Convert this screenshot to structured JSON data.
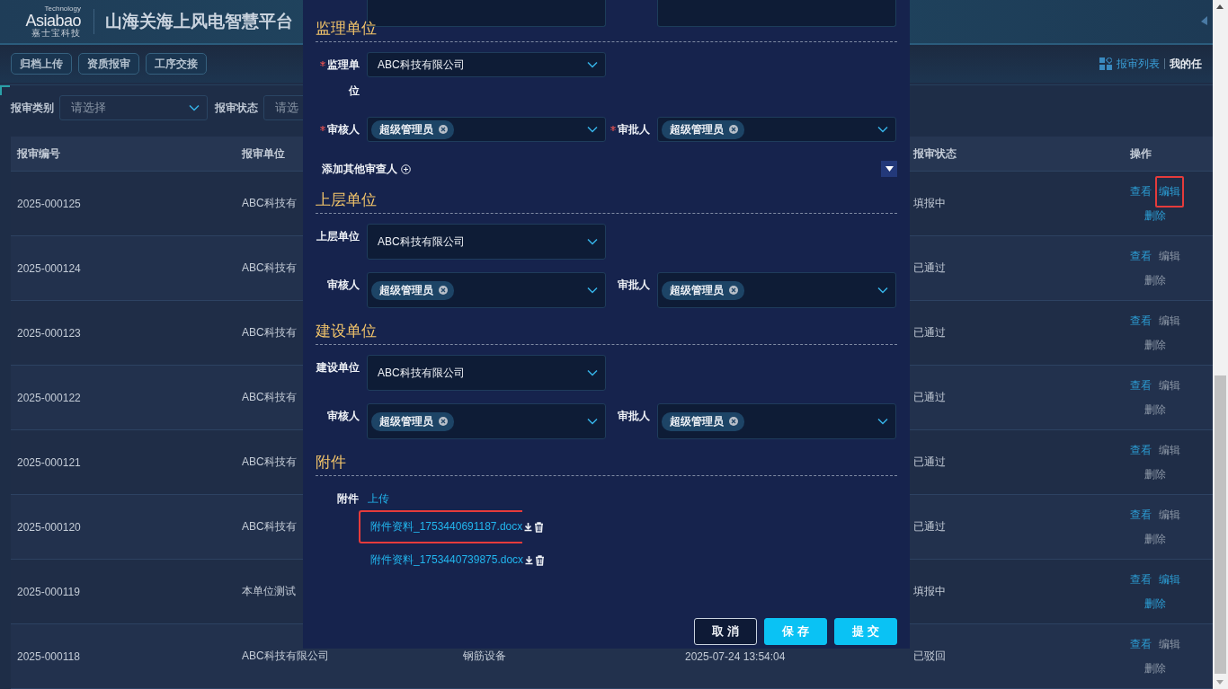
{
  "header": {
    "logo": {
      "tagline": "Technology",
      "name": "Asiabao",
      "subtitle": "嘉士宝科技"
    },
    "title": "山海关海上风电智慧平台"
  },
  "toolbar": {
    "buttons": [
      "归档上传",
      "资质报审",
      "工序交接"
    ],
    "tabs": [
      {
        "label": "报审列表",
        "selected": true
      },
      {
        "label": "我的任",
        "selected": false
      }
    ]
  },
  "filters": [
    {
      "label": "报审类别",
      "placeholder": "请选择"
    },
    {
      "label": "报审状态",
      "placeholder": "请选"
    }
  ],
  "table": {
    "columns": {
      "number": "报审编号",
      "unit": "报审单位",
      "status": "报审状态",
      "actions": "操作"
    },
    "rows": [
      {
        "number": "2025-000125",
        "unit": "ABC科技有",
        "status": "填报中",
        "actions": [
          {
            "label": "查看",
            "enabled": true,
            "highlighted": false
          },
          {
            "label": "编辑",
            "enabled": true,
            "highlighted": true
          },
          {
            "label": "删除",
            "enabled": true,
            "highlighted": false
          }
        ]
      },
      {
        "number": "2025-000124",
        "unit": "ABC科技有",
        "status": "已通过",
        "actions": [
          {
            "label": "查看",
            "enabled": true,
            "highlighted": false
          },
          {
            "label": "编辑",
            "enabled": false,
            "highlighted": false
          },
          {
            "label": "删除",
            "enabled": false,
            "highlighted": false
          }
        ]
      },
      {
        "number": "2025-000123",
        "unit": "ABC科技有",
        "status": "已通过",
        "actions": [
          {
            "label": "查看",
            "enabled": true,
            "highlighted": false
          },
          {
            "label": "编辑",
            "enabled": false,
            "highlighted": false
          },
          {
            "label": "删除",
            "enabled": false,
            "highlighted": false
          }
        ]
      },
      {
        "number": "2025-000122",
        "unit": "ABC科技有",
        "status": "已通过",
        "actions": [
          {
            "label": "查看",
            "enabled": true,
            "highlighted": false
          },
          {
            "label": "编辑",
            "enabled": false,
            "highlighted": false
          },
          {
            "label": "删除",
            "enabled": false,
            "highlighted": false
          }
        ]
      },
      {
        "number": "2025-000121",
        "unit": "ABC科技有",
        "status": "已通过",
        "actions": [
          {
            "label": "查看",
            "enabled": true,
            "highlighted": false
          },
          {
            "label": "编辑",
            "enabled": false,
            "highlighted": false
          },
          {
            "label": "删除",
            "enabled": false,
            "highlighted": false
          }
        ]
      },
      {
        "number": "2025-000120",
        "unit": "ABC科技有",
        "status": "已通过",
        "actions": [
          {
            "label": "查看",
            "enabled": true,
            "highlighted": false
          },
          {
            "label": "编辑",
            "enabled": false,
            "highlighted": false
          },
          {
            "label": "删除",
            "enabled": false,
            "highlighted": false
          }
        ]
      },
      {
        "number": "2025-000119",
        "unit": "本单位测试",
        "status": "填报中",
        "actions": [
          {
            "label": "查看",
            "enabled": true,
            "highlighted": false
          },
          {
            "label": "编辑",
            "enabled": true,
            "highlighted": false
          },
          {
            "label": "删除",
            "enabled": true,
            "highlighted": false
          }
        ]
      },
      {
        "number": "2025-000118",
        "unit": "ABC科技有限公司",
        "column_3": "钢筋设备",
        "column_4": "2025-07-24 13:54:04",
        "status": "已驳回",
        "actions": [
          {
            "label": "查看",
            "enabled": true,
            "highlighted": false
          },
          {
            "label": "编辑",
            "enabled": false,
            "highlighted": false
          },
          {
            "label": "删除",
            "enabled": false,
            "highlighted": false
          }
        ]
      }
    ]
  },
  "modal": {
    "sections": [
      {
        "title": "监理单位",
        "fields": [
          {
            "label": "监理单位",
            "required": true,
            "kind": "select",
            "value": "ABC科技有限公司"
          },
          {
            "label": "审核人",
            "required": true,
            "kind": "tags",
            "tags": [
              "超级管理员"
            ]
          },
          {
            "label": "审批人",
            "required": true,
            "kind": "tags",
            "tags": [
              "超级管理员"
            ]
          }
        ],
        "add_link": "添加其他审查人"
      },
      {
        "title": "上层单位",
        "fields": [
          {
            "label": "上层单位",
            "required": false,
            "kind": "select",
            "value": "ABC科技有限公司"
          },
          {
            "label": "审核人",
            "required": false,
            "kind": "tags",
            "tags": [
              "超级管理员"
            ]
          },
          {
            "label": "审批人",
            "required": false,
            "kind": "tags",
            "tags": [
              "超级管理员"
            ]
          }
        ]
      },
      {
        "title": "建设单位",
        "fields": [
          {
            "label": "建设单位",
            "required": false,
            "kind": "select",
            "value": "ABC科技有限公司"
          },
          {
            "label": "审核人",
            "required": false,
            "kind": "tags",
            "tags": [
              "超级管理员"
            ]
          },
          {
            "label": "审批人",
            "required": false,
            "kind": "tags",
            "tags": [
              "超级管理员"
            ]
          }
        ]
      }
    ],
    "attachments": {
      "title": "附件",
      "label": "附件",
      "upload": "上传",
      "files": [
        {
          "name": "附件资料_1753440691187.docx",
          "highlighted": true
        },
        {
          "name": "附件资料_1753440739875.docx",
          "highlighted": false
        }
      ]
    },
    "buttons": [
      {
        "label": "取消",
        "kind": "secondary"
      },
      {
        "label": "保存",
        "kind": "primary"
      },
      {
        "label": "提交",
        "kind": "primary"
      }
    ]
  }
}
